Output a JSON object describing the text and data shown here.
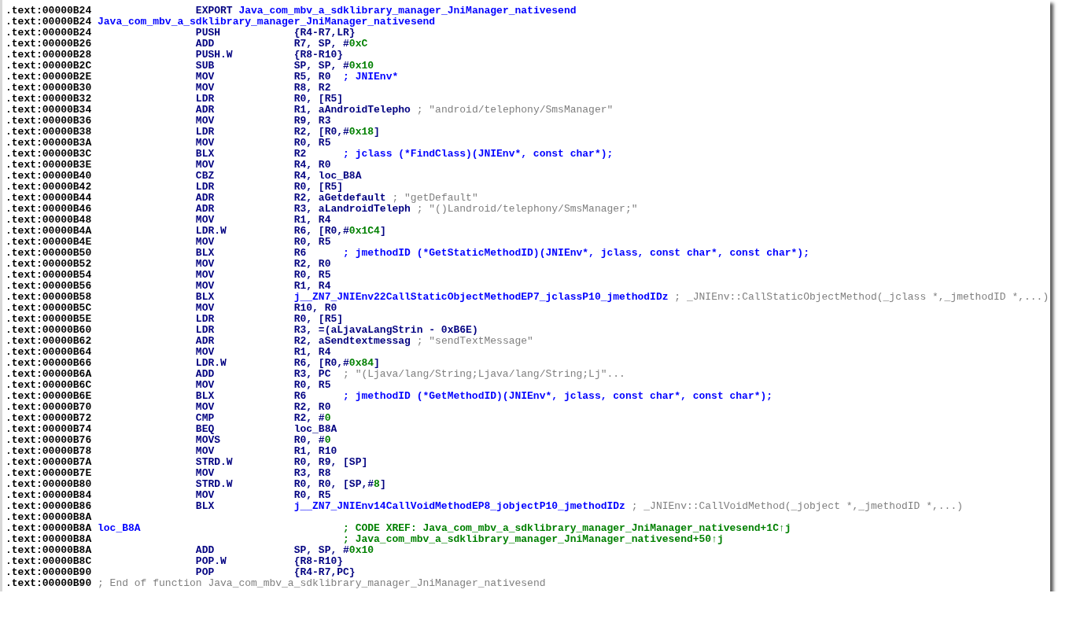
{
  "listing": [
    {
      "kind": "export",
      "address": ".text:00000B24",
      "mnemonic": "EXPORT",
      "symbol": "Java_com_mbv_a_sdklibrary_manager_JniManager_nativesend"
    },
    {
      "kind": "label",
      "address": ".text:00000B24",
      "label": "Java_com_mbv_a_sdklibrary_manager_JniManager_nativesend"
    },
    {
      "kind": "instruction",
      "address": ".text:00000B24",
      "mnemonic": "PUSH",
      "operands": [
        {
          "text": "{R4-R7,LR}",
          "kind": "reg"
        }
      ]
    },
    {
      "kind": "instruction",
      "address": ".text:00000B26",
      "mnemonic": "ADD",
      "operands": [
        {
          "text": "R7, SP, #",
          "kind": "reg"
        },
        {
          "text": "0xC",
          "kind": "imm"
        }
      ]
    },
    {
      "kind": "instruction",
      "address": ".text:00000B28",
      "mnemonic": "PUSH.W",
      "operands": [
        {
          "text": "{R8-R10}",
          "kind": "reg"
        }
      ]
    },
    {
      "kind": "instruction",
      "address": ".text:00000B2C",
      "mnemonic": "SUB",
      "operands": [
        {
          "text": "SP, SP, #",
          "kind": "reg"
        },
        {
          "text": "0x10",
          "kind": "imm"
        }
      ]
    },
    {
      "kind": "instruction",
      "address": ".text:00000B2E",
      "mnemonic": "MOV",
      "operands": [
        {
          "text": "R5, R0",
          "kind": "reg"
        }
      ],
      "comment": {
        "text": "; JNIEnv*",
        "kind": "note"
      }
    },
    {
      "kind": "instruction",
      "address": ".text:00000B30",
      "mnemonic": "MOV",
      "operands": [
        {
          "text": "R8, R2",
          "kind": "reg"
        }
      ]
    },
    {
      "kind": "instruction",
      "address": ".text:00000B32",
      "mnemonic": "LDR",
      "operands": [
        {
          "text": "R0, [R5]",
          "kind": "reg"
        }
      ]
    },
    {
      "kind": "instruction",
      "address": ".text:00000B34",
      "mnemonic": "ADR",
      "operands": [
        {
          "text": "R1, aAndroidTelepho",
          "kind": "reg"
        }
      ],
      "comment": {
        "text": "; \"android/telephony/SmsManager\"",
        "kind": "string"
      }
    },
    {
      "kind": "instruction",
      "address": ".text:00000B36",
      "mnemonic": "MOV",
      "operands": [
        {
          "text": "R9, R3",
          "kind": "reg"
        }
      ]
    },
    {
      "kind": "instruction",
      "address": ".text:00000B38",
      "mnemonic": "LDR",
      "operands": [
        {
          "text": "R2, [R0,#",
          "kind": "reg"
        },
        {
          "text": "0x18",
          "kind": "imm"
        },
        {
          "text": "]",
          "kind": "reg"
        }
      ]
    },
    {
      "kind": "instruction",
      "address": ".text:00000B3A",
      "mnemonic": "MOV",
      "operands": [
        {
          "text": "R0, R5",
          "kind": "reg"
        }
      ]
    },
    {
      "kind": "instruction",
      "address": ".text:00000B3C",
      "mnemonic": "BLX",
      "operands": [
        {
          "text": "R2",
          "kind": "reg"
        }
      ],
      "comment": {
        "text": "; jclass (*FindClass)(JNIEnv*, const char*);",
        "kind": "note"
      }
    },
    {
      "kind": "instruction",
      "address": ".text:00000B3E",
      "mnemonic": "MOV",
      "operands": [
        {
          "text": "R4, R0",
          "kind": "reg"
        }
      ]
    },
    {
      "kind": "instruction",
      "address": ".text:00000B40",
      "mnemonic": "CBZ",
      "operands": [
        {
          "text": "R4, loc_B8A",
          "kind": "reg"
        }
      ]
    },
    {
      "kind": "instruction",
      "address": ".text:00000B42",
      "mnemonic": "LDR",
      "operands": [
        {
          "text": "R0, [R5]",
          "kind": "reg"
        }
      ]
    },
    {
      "kind": "instruction",
      "address": ".text:00000B44",
      "mnemonic": "ADR",
      "operands": [
        {
          "text": "R2, aGetdefault",
          "kind": "reg"
        }
      ],
      "comment": {
        "text": "; \"getDefault\"",
        "kind": "string"
      }
    },
    {
      "kind": "instruction",
      "address": ".text:00000B46",
      "mnemonic": "ADR",
      "operands": [
        {
          "text": "R3, aLandroidTeleph",
          "kind": "reg"
        }
      ],
      "comment": {
        "text": "; \"()Landroid/telephony/SmsManager;\"",
        "kind": "string"
      }
    },
    {
      "kind": "instruction",
      "address": ".text:00000B48",
      "mnemonic": "MOV",
      "operands": [
        {
          "text": "R1, R4",
          "kind": "reg"
        }
      ]
    },
    {
      "kind": "instruction",
      "address": ".text:00000B4A",
      "mnemonic": "LDR.W",
      "operands": [
        {
          "text": "R6, [R0,#",
          "kind": "reg"
        },
        {
          "text": "0x1C4",
          "kind": "imm"
        },
        {
          "text": "]",
          "kind": "reg"
        }
      ]
    },
    {
      "kind": "instruction",
      "address": ".text:00000B4E",
      "mnemonic": "MOV",
      "operands": [
        {
          "text": "R0, R5",
          "kind": "reg"
        }
      ]
    },
    {
      "kind": "instruction",
      "address": ".text:00000B50",
      "mnemonic": "BLX",
      "operands": [
        {
          "text": "R6",
          "kind": "reg"
        }
      ],
      "comment": {
        "text": "; jmethodID (*GetStaticMethodID)(JNIEnv*, jclass, const char*, const char*);",
        "kind": "note"
      }
    },
    {
      "kind": "instruction",
      "address": ".text:00000B52",
      "mnemonic": "MOV",
      "operands": [
        {
          "text": "R2, R0",
          "kind": "reg"
        }
      ]
    },
    {
      "kind": "instruction",
      "address": ".text:00000B54",
      "mnemonic": "MOV",
      "operands": [
        {
          "text": "R0, R5",
          "kind": "reg"
        }
      ]
    },
    {
      "kind": "instruction",
      "address": ".text:00000B56",
      "mnemonic": "MOV",
      "operands": [
        {
          "text": "R1, R4",
          "kind": "reg"
        }
      ]
    },
    {
      "kind": "instruction",
      "address": ".text:00000B58",
      "mnemonic": "BLX",
      "operands": [
        {
          "text": "j__ZN7_JNIEnv22CallStaticObjectMethodEP7_jclassP10_jmethodIDz",
          "kind": "func"
        }
      ],
      "comment": {
        "text": "; _JNIEnv::CallStaticObjectMethod(_jclass *,_jmethodID *,...)",
        "kind": "string"
      }
    },
    {
      "kind": "instruction",
      "address": ".text:00000B5C",
      "mnemonic": "MOV",
      "operands": [
        {
          "text": "R10, R0",
          "kind": "reg"
        }
      ]
    },
    {
      "kind": "instruction",
      "address": ".text:00000B5E",
      "mnemonic": "LDR",
      "operands": [
        {
          "text": "R0, [R5]",
          "kind": "reg"
        }
      ]
    },
    {
      "kind": "instruction",
      "address": ".text:00000B60",
      "mnemonic": "LDR",
      "operands": [
        {
          "text": "R3, =(aLjavaLangStrin - 0xB6E)",
          "kind": "reg"
        }
      ]
    },
    {
      "kind": "instruction",
      "address": ".text:00000B62",
      "mnemonic": "ADR",
      "operands": [
        {
          "text": "R2, aSendtextmessag",
          "kind": "reg"
        }
      ],
      "comment": {
        "text": "; \"sendTextMessage\"",
        "kind": "string"
      }
    },
    {
      "kind": "instruction",
      "address": ".text:00000B64",
      "mnemonic": "MOV",
      "operands": [
        {
          "text": "R1, R4",
          "kind": "reg"
        }
      ]
    },
    {
      "kind": "instruction",
      "address": ".text:00000B66",
      "mnemonic": "LDR.W",
      "operands": [
        {
          "text": "R6, [R0,#",
          "kind": "reg"
        },
        {
          "text": "0x84",
          "kind": "imm"
        },
        {
          "text": "]",
          "kind": "reg"
        }
      ]
    },
    {
      "kind": "instruction",
      "address": ".text:00000B6A",
      "mnemonic": "ADD",
      "operands": [
        {
          "text": "R3, PC",
          "kind": "reg"
        }
      ],
      "comment": {
        "text": "; \"(Ljava/lang/String;Ljava/lang/String;Lj\"...",
        "kind": "string"
      }
    },
    {
      "kind": "instruction",
      "address": ".text:00000B6C",
      "mnemonic": "MOV",
      "operands": [
        {
          "text": "R0, R5",
          "kind": "reg"
        }
      ]
    },
    {
      "kind": "instruction",
      "address": ".text:00000B6E",
      "mnemonic": "BLX",
      "operands": [
        {
          "text": "R6",
          "kind": "reg"
        }
      ],
      "comment": {
        "text": "; jmethodID (*GetMethodID)(JNIEnv*, jclass, const char*, const char*);",
        "kind": "note"
      }
    },
    {
      "kind": "instruction",
      "address": ".text:00000B70",
      "mnemonic": "MOV",
      "operands": [
        {
          "text": "R2, R0",
          "kind": "reg"
        }
      ]
    },
    {
      "kind": "instruction",
      "address": ".text:00000B72",
      "mnemonic": "CMP",
      "operands": [
        {
          "text": "R2, #",
          "kind": "reg"
        },
        {
          "text": "0",
          "kind": "imm"
        }
      ]
    },
    {
      "kind": "instruction",
      "address": ".text:00000B74",
      "mnemonic": "BEQ",
      "operands": [
        {
          "text": "loc_B8A",
          "kind": "reg"
        }
      ]
    },
    {
      "kind": "instruction",
      "address": ".text:00000B76",
      "mnemonic": "MOVS",
      "operands": [
        {
          "text": "R0, #",
          "kind": "reg"
        },
        {
          "text": "0",
          "kind": "imm"
        }
      ]
    },
    {
      "kind": "instruction",
      "address": ".text:00000B78",
      "mnemonic": "MOV",
      "operands": [
        {
          "text": "R1, R10",
          "kind": "reg"
        }
      ]
    },
    {
      "kind": "instruction",
      "address": ".text:00000B7A",
      "mnemonic": "STRD.W",
      "operands": [
        {
          "text": "R0, R9, [SP]",
          "kind": "reg"
        }
      ]
    },
    {
      "kind": "instruction",
      "address": ".text:00000B7E",
      "mnemonic": "MOV",
      "operands": [
        {
          "text": "R3, R8",
          "kind": "reg"
        }
      ]
    },
    {
      "kind": "instruction",
      "address": ".text:00000B80",
      "mnemonic": "STRD.W",
      "operands": [
        {
          "text": "R0, R0, [SP,#",
          "kind": "reg"
        },
        {
          "text": "8",
          "kind": "imm"
        },
        {
          "text": "]",
          "kind": "reg"
        }
      ]
    },
    {
      "kind": "instruction",
      "address": ".text:00000B84",
      "mnemonic": "MOV",
      "operands": [
        {
          "text": "R0, R5",
          "kind": "reg"
        }
      ]
    },
    {
      "kind": "instruction",
      "address": ".text:00000B86",
      "mnemonic": "BLX",
      "operands": [
        {
          "text": "j__ZN7_JNIEnv14CallVoidMethodEP8_jobjectP10_jmethodIDz",
          "kind": "func"
        }
      ],
      "comment": {
        "text": "; _JNIEnv::CallVoidMethod(_jobject *,_jmethodID *,...)",
        "kind": "string"
      }
    },
    {
      "kind": "blank",
      "address": ".text:00000B8A"
    },
    {
      "kind": "xref",
      "address": ".text:00000B8A",
      "label": "loc_B8A",
      "comment": {
        "text": "; CODE XREF: Java_com_mbv_a_sdklibrary_manager_JniManager_nativesend+1C↑j",
        "kind": "xref"
      }
    },
    {
      "kind": "xref",
      "address": ".text:00000B8A",
      "comment": {
        "text": "; Java_com_mbv_a_sdklibrary_manager_JniManager_nativesend+50↑j",
        "kind": "xref"
      }
    },
    {
      "kind": "instruction",
      "address": ".text:00000B8A",
      "mnemonic": "ADD",
      "operands": [
        {
          "text": "SP, SP, #",
          "kind": "reg"
        },
        {
          "text": "0x10",
          "kind": "imm"
        }
      ]
    },
    {
      "kind": "instruction",
      "address": ".text:00000B8C",
      "mnemonic": "POP.W",
      "operands": [
        {
          "text": "{R8-R10}",
          "kind": "reg"
        }
      ]
    },
    {
      "kind": "instruction",
      "address": ".text:00000B90",
      "mnemonic": "POP",
      "operands": [
        {
          "text": "{R4-R7,PC}",
          "kind": "reg"
        }
      ]
    },
    {
      "kind": "end",
      "address": ".text:00000B90",
      "comment": {
        "text": "; End of function Java_com_mbv_a_sdklibrary_manager_JniManager_nativesend",
        "kind": "string"
      }
    }
  ]
}
